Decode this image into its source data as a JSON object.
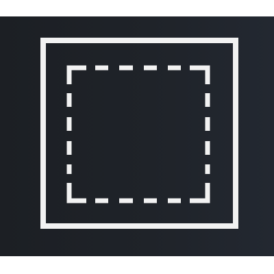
{
  "icon": {
    "name": "selection-frame-icon",
    "accent_color": "#f2f2f2",
    "background_color": "#1f2329"
  }
}
